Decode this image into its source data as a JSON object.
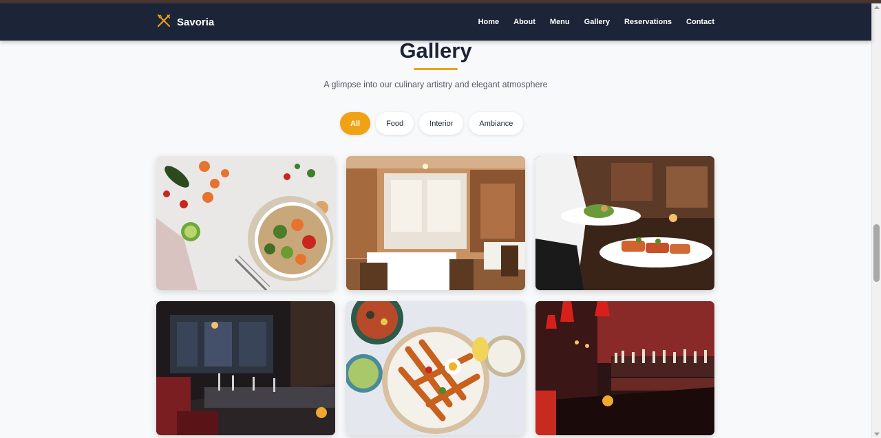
{
  "brand": {
    "name": "Savoria",
    "icon": "utensils-icon",
    "accent": "#f0a215"
  },
  "nav": {
    "items": [
      "Home",
      "About",
      "Menu",
      "Gallery",
      "Reservations",
      "Contact"
    ]
  },
  "section": {
    "title": "Gallery",
    "subtitle": "A glimpse into our culinary artistry and elegant atmosphere"
  },
  "filters": {
    "items": [
      "All",
      "Food",
      "Interior",
      "Ambiance"
    ],
    "active": "All"
  },
  "gallery": {
    "images": [
      {
        "kind": "food",
        "subject": "vegetable grain bowl"
      },
      {
        "kind": "interior",
        "subject": "dining room"
      },
      {
        "kind": "food",
        "subject": "waiter serving plates"
      },
      {
        "kind": "ambiance",
        "subject": "evening dining tables"
      },
      {
        "kind": "food",
        "subject": "sweet potato fries platter"
      },
      {
        "kind": "ambiance",
        "subject": "bar with red lighting"
      }
    ]
  },
  "colors": {
    "navbar": "#1c2438",
    "accent": "#f0a215",
    "background": "#f8f9fb"
  }
}
